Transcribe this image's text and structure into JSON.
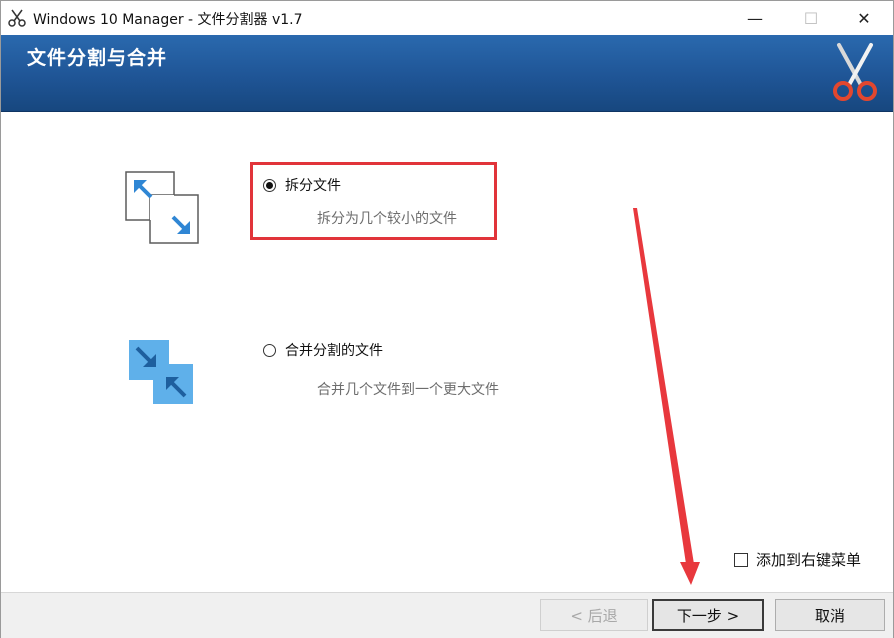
{
  "window": {
    "title": "Windows 10 Manager - 文件分割器 v1.7",
    "minimize_glyph": "—",
    "maximize_glyph": "☐",
    "close_glyph": "✕"
  },
  "banner": {
    "title": "文件分割与合并",
    "icon": "scissors-icon"
  },
  "options": [
    {
      "label": "拆分文件",
      "description": "拆分为几个较小的文件",
      "selected": true,
      "icon": "split-file-icon"
    },
    {
      "label": "合并分割的文件",
      "description": "合并几个文件到一个更大文件",
      "selected": false,
      "icon": "merge-file-icon"
    }
  ],
  "context_menu_checkbox": {
    "label": "添加到右键菜单",
    "checked": false
  },
  "buttons": {
    "back": "< 后退",
    "next": "下一步 >",
    "cancel": "取消"
  },
  "colors": {
    "banner": "#1f5596",
    "highlight": "#e1343a",
    "icon_blue": "#3a8fd6"
  }
}
